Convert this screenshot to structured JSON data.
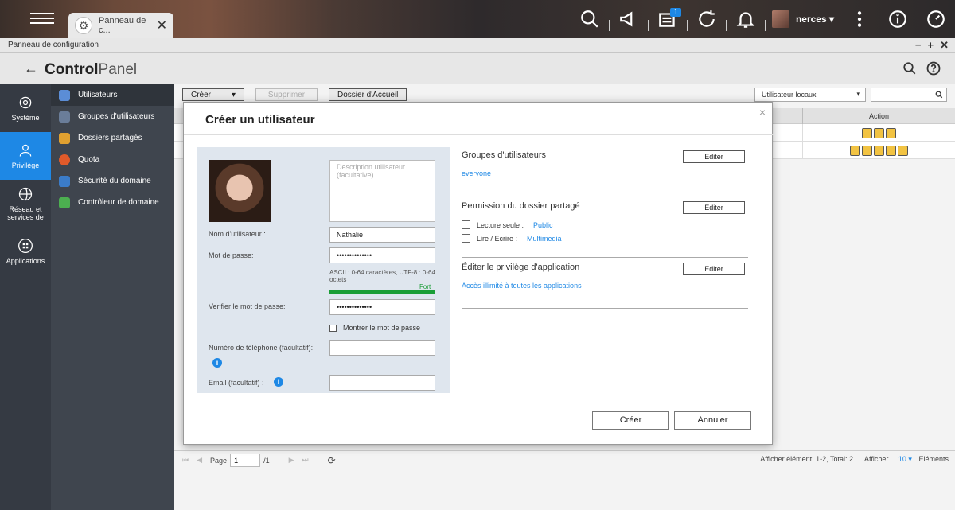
{
  "topbar": {
    "tab_label": "Panneau de c...",
    "tab_close": "✕",
    "notification_count": "1",
    "username": "nerces ▾"
  },
  "window": {
    "title": "Panneau de configuration",
    "minimize": "−",
    "maximize": "+",
    "close": "✕"
  },
  "app": {
    "back": "←",
    "brand_bold": "Control",
    "brand_light": "Panel"
  },
  "sidebar": [
    {
      "label": "Système"
    },
    {
      "label": "Privilège"
    },
    {
      "label": "Réseau et services de"
    },
    {
      "label": "Applications"
    }
  ],
  "subnav": [
    {
      "label": "Utilisateurs",
      "color": "#5b8dd6"
    },
    {
      "label": "Groupes d'utilisateurs",
      "color": "#6a7d99"
    },
    {
      "label": "Dossiers partagés",
      "color": "#e0a030"
    },
    {
      "label": "Quota",
      "color": "#e05a2a"
    },
    {
      "label": "Sécurité du domaine",
      "color": "#3b7cc9"
    },
    {
      "label": "Contrôleur de domaine",
      "color": "#4caf50"
    }
  ],
  "toolbar": {
    "create": "Créer",
    "create_arrow": "▾",
    "delete": "Supprimer",
    "home_folder": "Dossier d'Accueil",
    "filter": "Utilisateur locaux",
    "filter_arrow": "▾"
  },
  "grid": {
    "action_header": "Action"
  },
  "pager": {
    "page_label": "Page",
    "page_value": "1",
    "total_pages": "/1",
    "summary": "Afficher élément: 1-2, Total: 2",
    "show": "Afficher",
    "per_page": "10",
    "per_page_arrow": "▾",
    "items": "Eléments"
  },
  "modal": {
    "title": "Créer un utilisateur",
    "close": "×",
    "description_placeholder": "Description utilisateur (facultative)",
    "username_label": "Nom d'utilisateur :",
    "username_value": "Nathalie",
    "password_label": "Mot de passe:",
    "password_value": "••••••••••••••",
    "password_hint": "ASCII : 0-64 caractères, UTF-8 : 0-64 octets",
    "strength": "Fort",
    "strength_level": 1.0,
    "verify_label": "Verifier le mot de passe:",
    "verify_value": "••••••••••••••",
    "show_password": "Montrer le mot de passe",
    "phone_label": "Numéro de téléphone (facultatif):",
    "email_label": "Email (facultatif) :",
    "info_glyph": "i",
    "groups_title": "Groupes d'utilisateurs",
    "groups_value": "everyone",
    "edit": "Editer",
    "perm_title": "Permission du dossier partagé",
    "read_only_label": "Lecture seule :",
    "read_only_value": "Public",
    "read_write_label": "Lire / Ecrire :",
    "read_write_value": "Multimedia",
    "app_priv_title": "Éditer le privilège d'application",
    "app_priv_value": "Accès illimité à toutes les applications",
    "create_btn": "Créer",
    "cancel_btn": "Annuler"
  }
}
